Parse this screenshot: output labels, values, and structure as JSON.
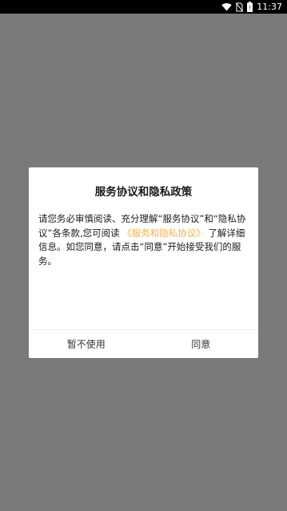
{
  "status_bar": {
    "time": "11:37",
    "icons": [
      "wifi-icon",
      "no-sim-icon",
      "battery-icon"
    ]
  },
  "dialog": {
    "title": "服务协议和隐私政策",
    "body_part1": "请您务必审慎阅读、充分理解“服务协议”和“隐私协议”各条款,您可阅读",
    "link_text": "《服务和隐私协议》",
    "body_part2": "了解详细信息。如您同意，请点击“同意”开始接受我们的服务。",
    "decline_label": "暂不使用",
    "accept_label": "同意",
    "link_color": "#f6b24a"
  },
  "colors": {
    "overlay": "#7a7a7a",
    "status_bar": "#000000",
    "dialog_bg": "#ffffff"
  }
}
